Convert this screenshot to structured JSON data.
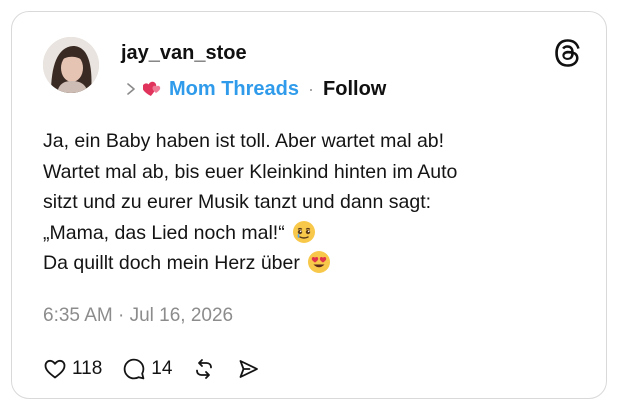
{
  "post": {
    "username": "jay_van_stoe",
    "community": "Mom Threads",
    "separator": "·",
    "follow_label": "Follow",
    "lines": [
      "Ja, ein Baby haben ist toll. Aber wartet mal ab!",
      "Wartet mal ab, bis euer Kleinkind hinten im Auto",
      "sitzt und zu eurer Musik tanzt und dann sagt:",
      "„Mama, das Lied noch mal!“",
      "Da quillt doch mein Herz über"
    ],
    "emoji_line4": "teary-smile-emoji",
    "emoji_line5": "heart-eyes-emoji",
    "timestamp": "6:35 AM · Jul 16, 2026",
    "likes": "118",
    "replies": "14"
  },
  "colors": {
    "community": "#2f9bea",
    "community_icon": "#e0345c",
    "meta": "#8c8c8c",
    "border": "#d9d9d9"
  },
  "icons": [
    "threads-logo-icon",
    "chevron-right-icon",
    "hearts-icon",
    "heart-icon",
    "comment-icon",
    "repost-icon",
    "share-icon"
  ]
}
